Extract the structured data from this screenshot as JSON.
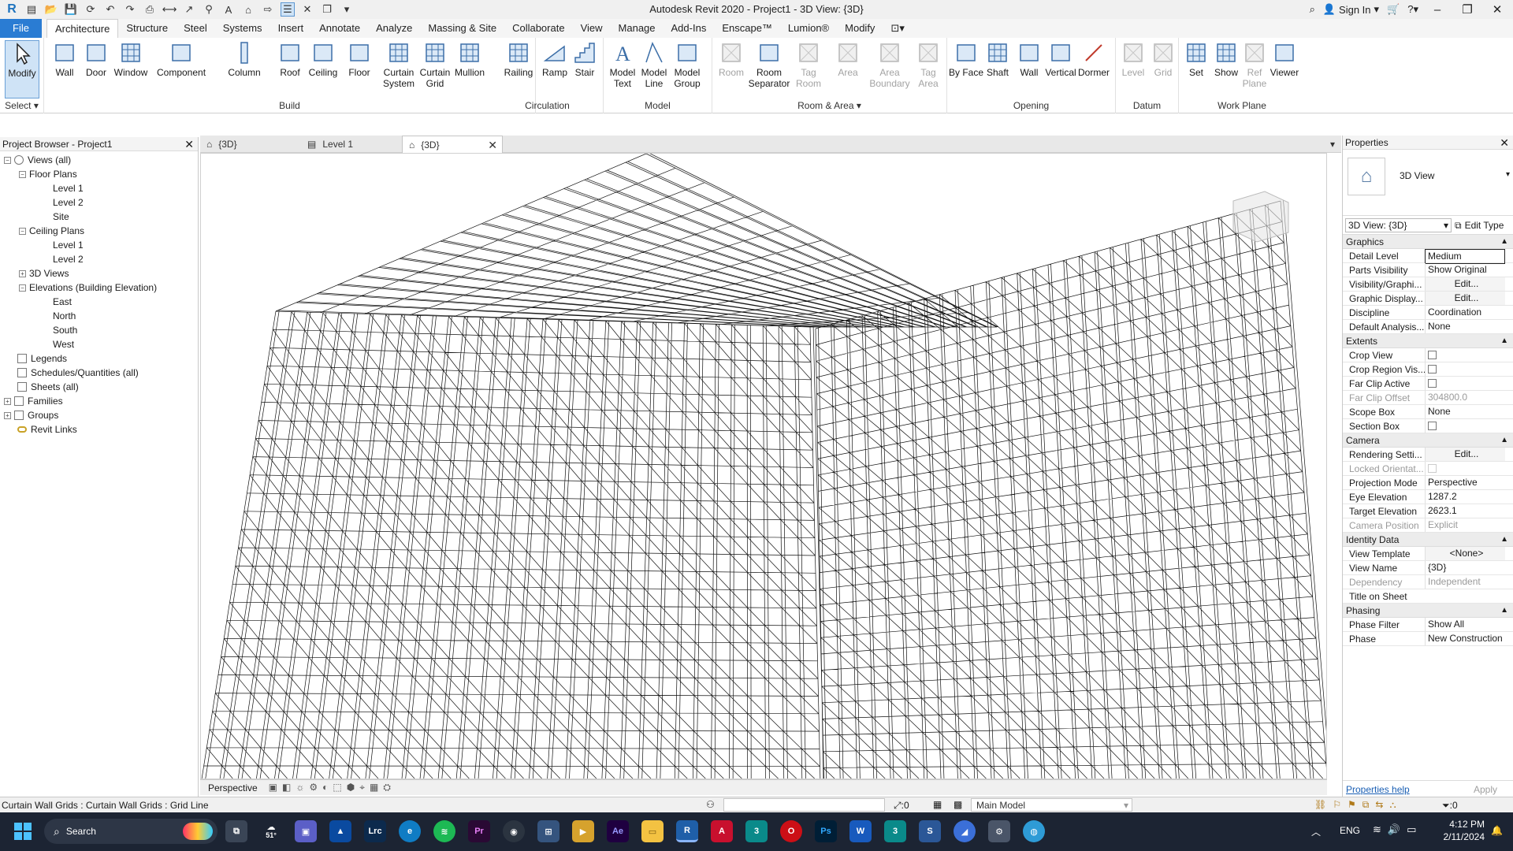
{
  "window": {
    "title": "Autodesk Revit 2020 - Project1 - 3D View: {3D}",
    "sign_in": "Sign In"
  },
  "menu_tabs": [
    "File",
    "Architecture",
    "Structure",
    "Steel",
    "Systems",
    "Insert",
    "Annotate",
    "Analyze",
    "Massing & Site",
    "Collaborate",
    "View",
    "Manage",
    "Add-Ins",
    "Enscape™",
    "Lumion®",
    "Modify"
  ],
  "ribbon": {
    "groups": {
      "select": "Select",
      "build": "Build",
      "circulation": "Circulation",
      "model": "Model",
      "room_area": "Room & Area",
      "opening": "Opening",
      "datum": "Datum",
      "work_plane": "Work Plane"
    },
    "buttons": {
      "modify": "Modify",
      "wall": "Wall",
      "door": "Door",
      "window": "Window",
      "component": "Component",
      "column": "Column",
      "roof": "Roof",
      "ceiling": "Ceiling",
      "floor": "Floor",
      "curtain_system": "Curtain System",
      "curtain_grid": "Curtain Grid",
      "mullion": "Mullion",
      "railing": "Railing",
      "ramp": "Ramp",
      "stair": "Stair",
      "model_text": "Model Text",
      "model_line": "Model Line",
      "model_group": "Model Group",
      "room": "Room",
      "room_separator": "Room Separator",
      "tag_room": "Tag Room",
      "area": "Area",
      "area_boundary": "Area Boundary",
      "tag_area": "Tag Area",
      "by_face": "By Face",
      "shaft": "Shaft",
      "wall_opening": "Wall",
      "vertical": "Vertical",
      "dormer": "Dormer",
      "level": "Level",
      "grid": "Grid",
      "set": "Set",
      "show": "Show",
      "ref_plane": "Ref Plane",
      "viewer": "Viewer"
    }
  },
  "project_browser": {
    "title": "Project Browser - Project1",
    "tree": {
      "views_all": "Views (all)",
      "floor_plans": "Floor Plans",
      "fp_level1": "Level 1",
      "fp_level2": "Level 2",
      "fp_site": "Site",
      "ceiling_plans": "Ceiling Plans",
      "cp_level1": "Level 1",
      "cp_level2": "Level 2",
      "views_3d": "3D Views",
      "elevations": "Elevations (Building Elevation)",
      "east": "East",
      "north": "North",
      "south": "South",
      "west": "West",
      "legends": "Legends",
      "schedules": "Schedules/Quantities (all)",
      "sheets": "Sheets (all)",
      "families": "Families",
      "groups": "Groups",
      "revit_links": "Revit Links"
    }
  },
  "view_tabs": [
    "{3D}",
    "Level 1",
    "{3D}"
  ],
  "view_control": {
    "mode": "Perspective",
    "scale_value": "0"
  },
  "properties": {
    "title": "Properties",
    "type_name": "3D View",
    "selector": "3D View: {3D}",
    "edit_type": "Edit Type",
    "sections": {
      "graphics": "Graphics",
      "extents": "Extents",
      "camera": "Camera",
      "identity": "Identity Data",
      "phasing": "Phasing"
    },
    "rows": {
      "detail_level": {
        "k": "Detail Level",
        "v": "Medium"
      },
      "parts_visibility": {
        "k": "Parts Visibility",
        "v": "Show Original"
      },
      "visibility_graphics": {
        "k": "Visibility/Graphi...",
        "v": "Edit..."
      },
      "graphic_display": {
        "k": "Graphic Display...",
        "v": "Edit..."
      },
      "discipline": {
        "k": "Discipline",
        "v": "Coordination"
      },
      "default_analysis": {
        "k": "Default Analysis...",
        "v": "None"
      },
      "crop_view": {
        "k": "Crop View"
      },
      "crop_region": {
        "k": "Crop Region Vis..."
      },
      "far_clip_active": {
        "k": "Far Clip Active"
      },
      "far_clip_offset": {
        "k": "Far Clip Offset",
        "v": "304800.0"
      },
      "scope_box": {
        "k": "Scope Box",
        "v": "None"
      },
      "section_box": {
        "k": "Section Box"
      },
      "rendering_settings": {
        "k": "Rendering Setti...",
        "v": "Edit..."
      },
      "locked_orientation": {
        "k": "Locked Orientat..."
      },
      "projection_mode": {
        "k": "Projection Mode",
        "v": "Perspective"
      },
      "eye_elevation": {
        "k": "Eye Elevation",
        "v": "1287.2"
      },
      "target_elevation": {
        "k": "Target Elevation",
        "v": "2623.1"
      },
      "camera_position": {
        "k": "Camera Position",
        "v": "Explicit"
      },
      "view_template": {
        "k": "View Template",
        "v": "<None>"
      },
      "view_name": {
        "k": "View Name",
        "v": "{3D}"
      },
      "dependency": {
        "k": "Dependency",
        "v": "Independent"
      },
      "title_on_sheet": {
        "k": "Title on Sheet",
        "v": ""
      },
      "phase_filter": {
        "k": "Phase Filter",
        "v": "Show All"
      },
      "phase": {
        "k": "Phase",
        "v": "New Construction"
      }
    },
    "help_link": "Properties help",
    "apply": "Apply"
  },
  "status": {
    "message": "Curtain Wall Grids : Curtain Wall Grids : Grid Line",
    "selection_count": ":0",
    "model": "Main Model",
    "filter_count": ":0"
  },
  "taskbar": {
    "search": "Search",
    "temperature": "51°",
    "language": "ENG",
    "time": "4:12 PM",
    "date": "2/11/2024"
  },
  "colors": {
    "accent": "#2a7cd3",
    "taskbar": "#1c2433"
  }
}
